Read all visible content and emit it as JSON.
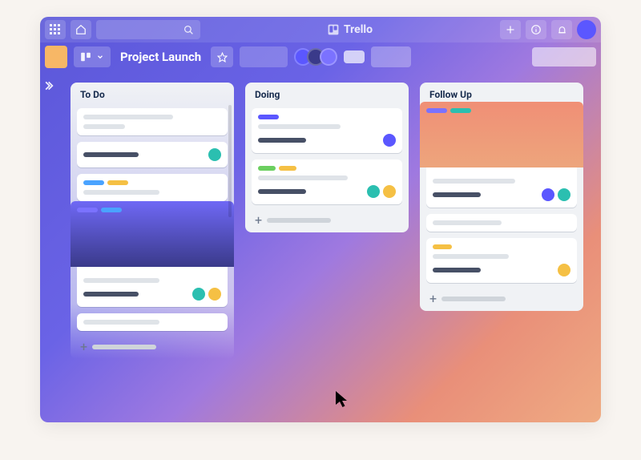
{
  "app": {
    "name": "Trello"
  },
  "board": {
    "title": "Project Launch"
  },
  "colors": {
    "accentPurple": "#5b57ff",
    "teal": "#2bbfb0",
    "blue": "#4aa3ff",
    "yellow": "#f5c044",
    "orange": "#f08f76",
    "green": "#6bcf5f"
  },
  "members": [
    {
      "color": "#5b57ff"
    },
    {
      "color": "#3a3a8a"
    },
    {
      "color": "#7b72ff"
    }
  ],
  "lists": [
    {
      "title": "To Do"
    },
    {
      "title": "Doing"
    },
    {
      "title": "Follow Up"
    }
  ]
}
